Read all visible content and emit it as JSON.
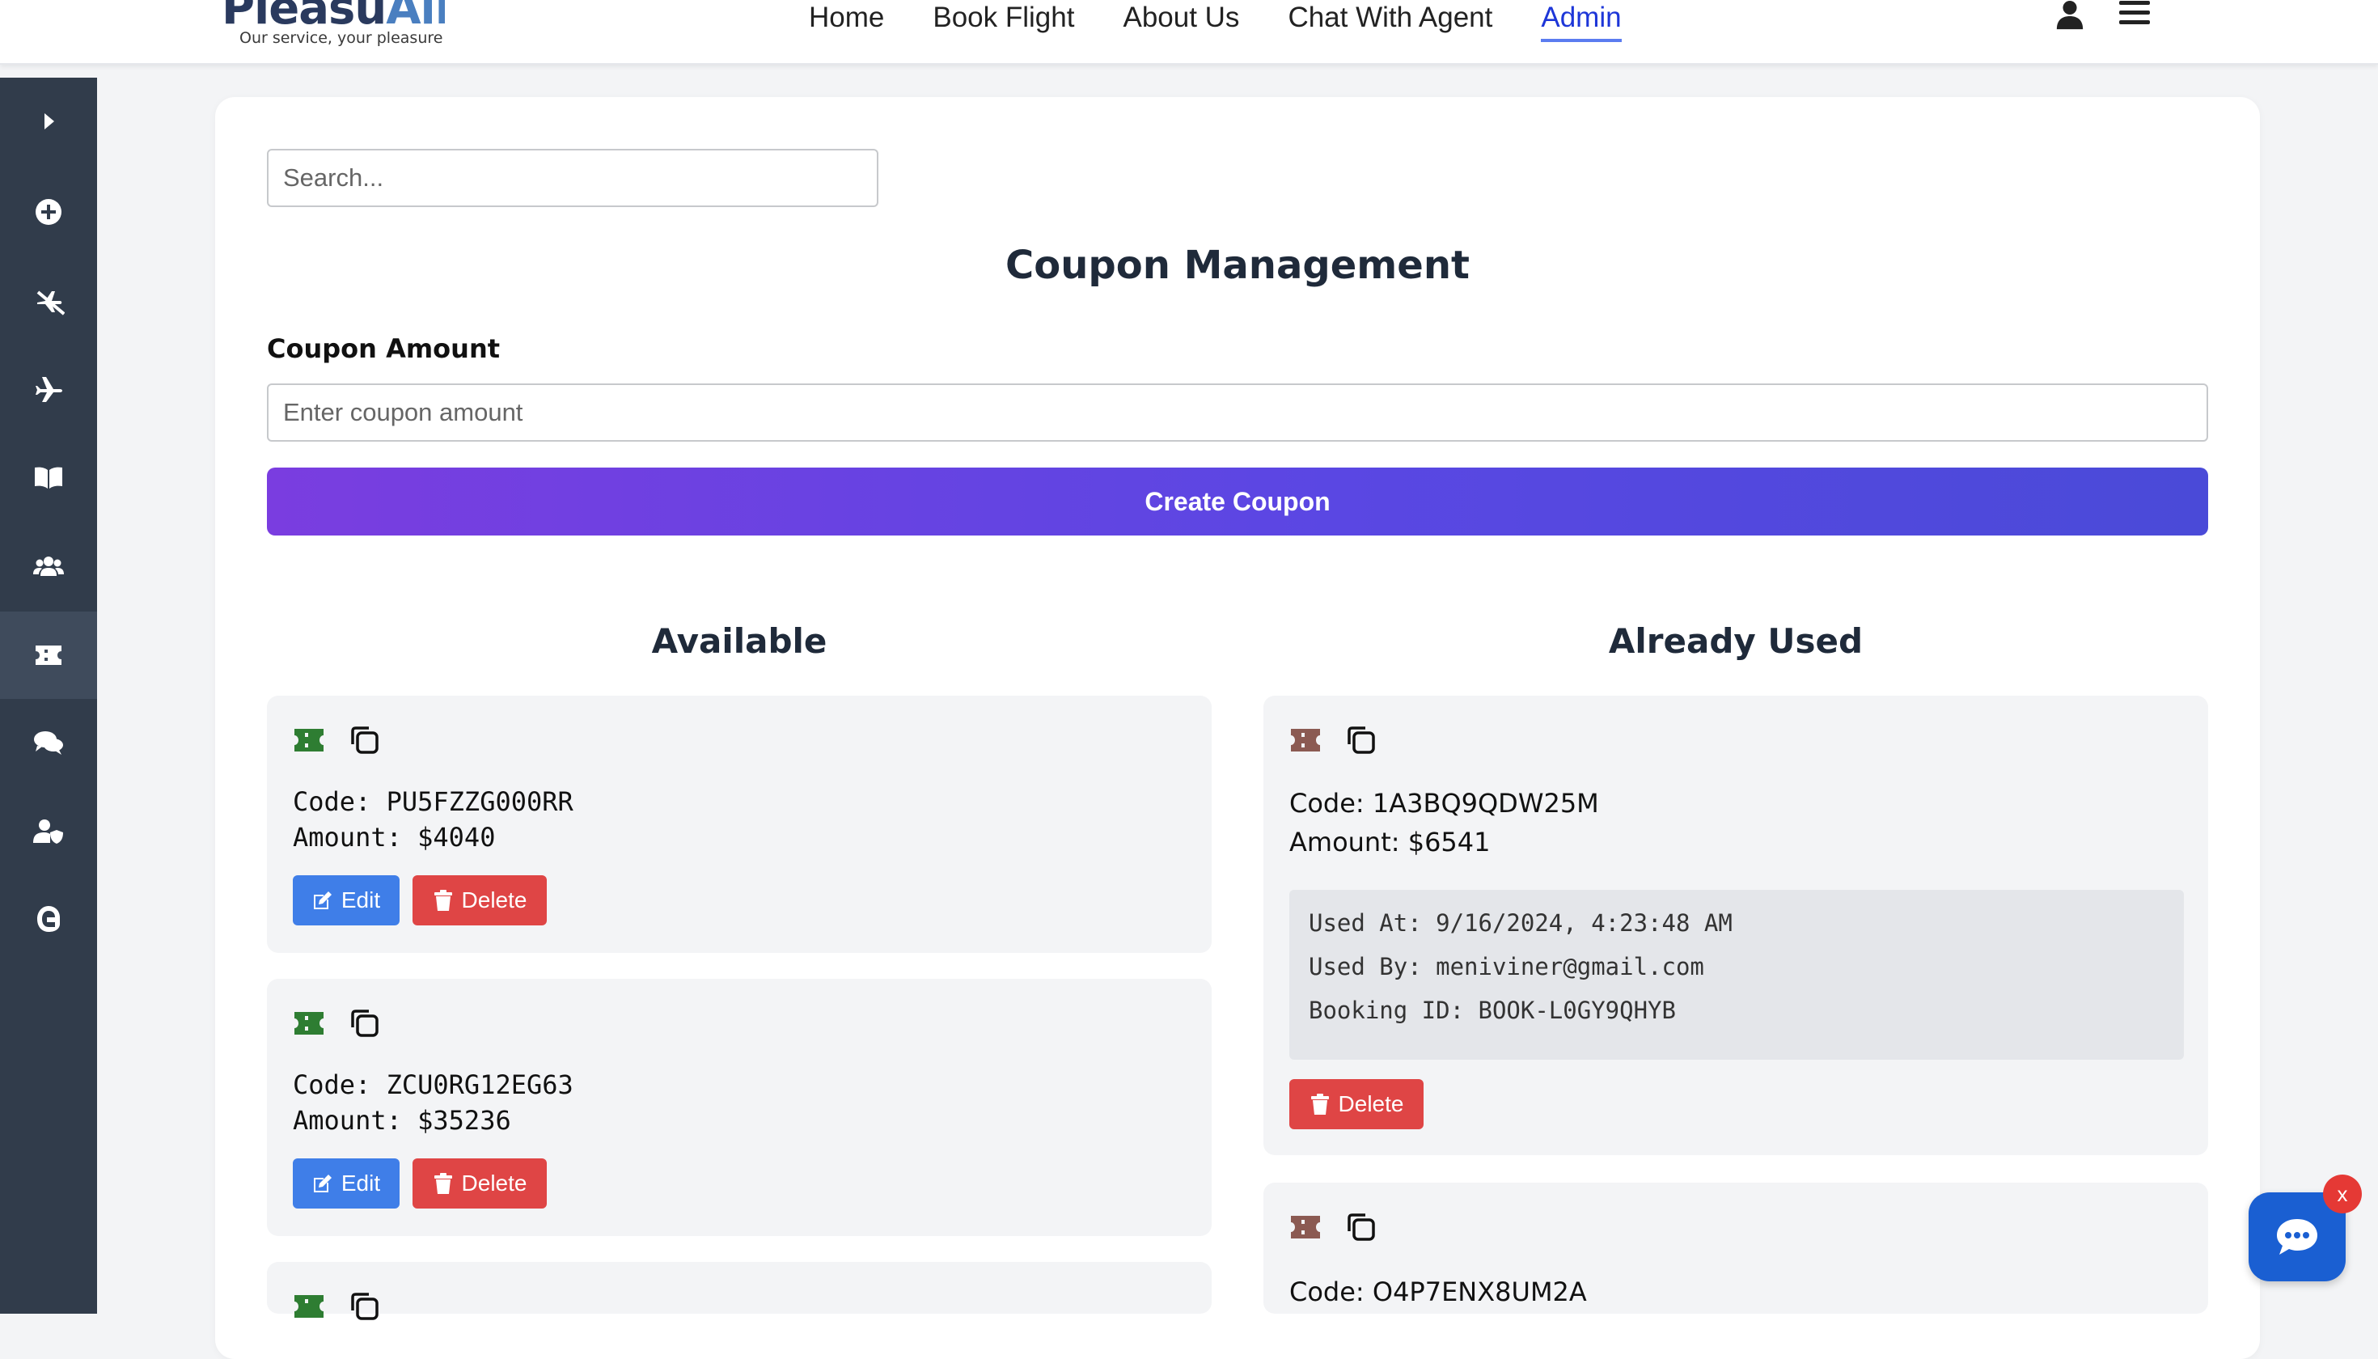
{
  "brand": {
    "name_part1": "Pleasu",
    "name_part2": "Air",
    "tagline": "Our service, your pleasure"
  },
  "nav": {
    "links": [
      {
        "label": "Home"
      },
      {
        "label": "Book Flight"
      },
      {
        "label": "About Us"
      },
      {
        "label": "Chat With Agent"
      },
      {
        "label": "Admin",
        "active": true
      }
    ]
  },
  "sidebar": {
    "items": [
      {
        "icon": "chevron-right-icon"
      },
      {
        "icon": "plus-circle-icon"
      },
      {
        "icon": "plane-slash-icon"
      },
      {
        "icon": "plane-icon"
      },
      {
        "icon": "book-open-icon"
      },
      {
        "icon": "users-icon"
      },
      {
        "icon": "ticket-icon",
        "active": true
      },
      {
        "icon": "comments-icon"
      },
      {
        "icon": "user-shield-icon"
      },
      {
        "icon": "passport-icon"
      }
    ]
  },
  "search": {
    "placeholder": "Search..."
  },
  "page": {
    "title": "Coupon Management",
    "amount_label": "Coupon Amount",
    "amount_placeholder": "Enter coupon amount",
    "create_button": "Create Coupon"
  },
  "columns": {
    "available_title": "Available",
    "used_title": "Already Used"
  },
  "available": [
    {
      "code": "Code: PU5FZZG000RR",
      "amount": "Amount: $4040",
      "edit": "Edit",
      "delete": "Delete"
    },
    {
      "code": "Code: ZCU0RG12EG63",
      "amount": "Amount: $35236",
      "edit": "Edit",
      "delete": "Delete"
    }
  ],
  "used": [
    {
      "code": "Code: 1A3BQ9QDW25M",
      "amount": "Amount: $6541",
      "used_at": "Used At: 9/16/2024, 4:23:48 AM",
      "used_by": "Used By: meniviner@gmail.com",
      "booking_id": "Booking ID: BOOK-L0GY9QHYB",
      "delete": "Delete"
    },
    {
      "code": "Code: O4P7ENX8UM2A"
    }
  ],
  "chat_widget": {
    "close_label": "x"
  },
  "colors": {
    "sidebar_bg": "#313c4b",
    "accent_gradient_start": "#7a3de0",
    "accent_gradient_end": "#4a4ad8",
    "edit_blue": "#3f7ee8",
    "delete_red": "#df4545",
    "ticket_green": "#2e7d32",
    "ticket_brown": "#8b5a52",
    "active_nav": "#1d36d8"
  }
}
